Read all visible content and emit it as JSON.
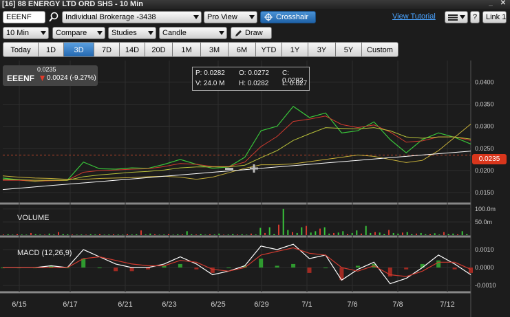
{
  "window": {
    "title": "[16] 88 ENERGY LTD ORD SHS - 10 Min"
  },
  "toolbar1": {
    "symbol": "EEENF",
    "account": "Individual Brokerage -3438",
    "view": "Pro View",
    "crosshair": "Crosshair",
    "tutorial": "View Tutorial",
    "help": "?",
    "link": "Link 1"
  },
  "toolbar2": {
    "interval": "10 Min",
    "compare": "Compare",
    "studies": "Studies",
    "chart_type": "Candle",
    "draw": "Draw"
  },
  "ranges": [
    "Today",
    "1D",
    "3D",
    "7D",
    "14D",
    "20D",
    "1M",
    "3M",
    "6M",
    "YTD",
    "1Y",
    "3Y",
    "5Y",
    "Custom"
  ],
  "active_range": "3D",
  "quote": {
    "symbol": "EEENF",
    "price": "0.0235",
    "change": "0.0024 (-9.27%)"
  },
  "ohlc": {
    "p": "P: 0.0282",
    "o": "O: 0.0272",
    "c": "C: 0.0282",
    "v": "V: 24.0 M",
    "h": "H: 0.0282",
    "l": "L: 0.027"
  },
  "price_tag": "0.0235",
  "panels": {
    "volume_label": "VOLUME",
    "macd_label": "MACD (12,26,9)"
  },
  "chart_data": [
    {
      "type": "line",
      "title": "EEENF price",
      "x_ticks": [
        "6/15",
        "6/17",
        "6/21",
        "6/23",
        "6/25",
        "6/29",
        "7/1",
        "7/6",
        "7/8",
        "7/12"
      ],
      "y_ticks": [
        "0.0400",
        "0.0350",
        "0.0300",
        "0.0250",
        "0.0200",
        "0.0150"
      ],
      "ylim": [
        0.013,
        0.043
      ],
      "series": [
        {
          "values": [
            0.0183,
            0.0179,
            0.0175,
            0.0178,
            0.0178,
            0.0219,
            0.0204,
            0.0203,
            0.0206,
            0.0205,
            0.0214,
            0.0225,
            0.0214,
            0.0205,
            0.0208,
            0.023,
            0.029,
            0.03,
            0.0345,
            0.032,
            0.033,
            0.0285,
            0.029,
            0.031,
            0.027,
            0.024,
            0.027,
            0.0285,
            0.0275,
            0.026
          ]
        },
        {
          "values": [
            0.0178,
            0.0178,
            0.0176,
            0.0177,
            0.0178,
            0.0196,
            0.02,
            0.0201,
            0.0203,
            0.0204,
            0.0209,
            0.0216,
            0.0214,
            0.0209,
            0.0209,
            0.0219,
            0.0254,
            0.0277,
            0.0311,
            0.0316,
            0.0323,
            0.0304,
            0.0297,
            0.0303,
            0.0287,
            0.0264,
            0.0267,
            0.0276,
            0.0276,
            0.0268
          ]
        },
        {
          "values": [
            0.018,
            0.0179,
            0.0178,
            0.0178,
            0.0178,
            0.0186,
            0.019,
            0.0193,
            0.0196,
            0.0198,
            0.0201,
            0.0206,
            0.0208,
            0.0208,
            0.0208,
            0.0212,
            0.0229,
            0.0245,
            0.0268,
            0.0283,
            0.0297,
            0.0295,
            0.0294,
            0.0297,
            0.029,
            0.0276,
            0.0273,
            0.0276,
            0.0276,
            0.0271
          ]
        },
        {
          "values": [
            0.0188,
            0.0185,
            0.0183,
            0.0182,
            0.018,
            0.018,
            0.0182,
            0.0183,
            0.0184,
            0.0186,
            0.0187,
            0.0185,
            0.018,
            0.0185,
            0.0195,
            0.0205,
            0.0213,
            0.0213,
            0.0215,
            0.022,
            0.0225,
            0.023,
            0.0235,
            0.0232,
            0.0225,
            0.0218,
            0.0223,
            0.0245,
            0.0275,
            0.0305
          ]
        },
        {
          "values": [
            0.0157,
            0.016,
            0.0163,
            0.0166,
            0.0169,
            0.0172,
            0.0175,
            0.0178,
            0.0181,
            0.0184,
            0.0187,
            0.019,
            0.0193,
            0.0196,
            0.0199,
            0.0202,
            0.0205,
            0.0208,
            0.0211,
            0.0214,
            0.0217,
            0.022,
            0.0223,
            0.0226,
            0.0229,
            0.0232,
            0.0235,
            0.0238,
            0.0241,
            0.0244
          ]
        }
      ]
    },
    {
      "type": "bar",
      "title": "VOLUME",
      "y_ticks": [
        "100.0m",
        "50.0m"
      ],
      "ylim": [
        0,
        110
      ],
      "values": [
        3,
        4,
        2,
        5,
        3,
        2,
        8,
        4,
        3,
        2,
        6,
        3,
        12,
        5,
        4,
        3,
        2,
        3,
        2,
        4,
        3,
        5,
        2,
        3,
        4,
        3,
        2,
        5,
        3,
        4,
        18,
        3,
        6,
        4,
        2,
        3,
        5,
        2,
        4,
        3,
        15,
        4,
        3,
        5,
        2,
        4,
        3,
        6,
        2,
        3,
        5,
        3,
        4,
        2,
        6,
        3,
        28,
        8,
        30,
        5,
        40,
        100,
        20,
        12,
        8,
        30,
        35,
        10,
        15,
        25,
        30,
        6,
        8,
        10,
        15,
        5,
        8,
        18,
        6,
        35,
        8,
        12,
        10,
        5,
        20,
        8,
        6,
        10,
        12,
        5,
        6,
        8,
        4,
        5,
        7,
        3,
        12,
        5,
        6,
        4,
        15,
        5
      ]
    },
    {
      "type": "line",
      "title": "MACD (12,26,9)",
      "y_ticks": [
        "0.0010",
        "0.0000",
        "-0.0010"
      ],
      "ylim": [
        -0.0013,
        0.0015
      ],
      "series": [
        {
          "values": [
            0.0,
            0.0,
            0.0,
            0.0001,
            0.0,
            0.001,
            0.0006,
            0.0002,
            0.0,
            0.0,
            0.0002,
            0.0006,
            0.0002,
            -0.0004,
            -0.0002,
            0.0001,
            0.0012,
            0.001,
            0.0013,
            0.0005,
            0.0007,
            -0.0007,
            -0.0001,
            0.0003,
            -0.0009,
            -0.0006,
            0.0,
            0.0007,
            0.0002,
            -0.0004
          ]
        },
        {
          "values": [
            0.0,
            0.0,
            0.0,
            0.0,
            0.0,
            0.0005,
            0.0006,
            0.0004,
            0.0002,
            0.0001,
            0.0001,
            0.0004,
            0.0003,
            -0.0001,
            -0.0002,
            0.0,
            0.0007,
            0.0009,
            0.0011,
            0.0008,
            0.0007,
            0.0,
            -0.0002,
            0.0001,
            -0.0004,
            -0.0005,
            -0.0002,
            0.0003,
            0.0003,
            -0.0001
          ]
        }
      ]
    }
  ]
}
